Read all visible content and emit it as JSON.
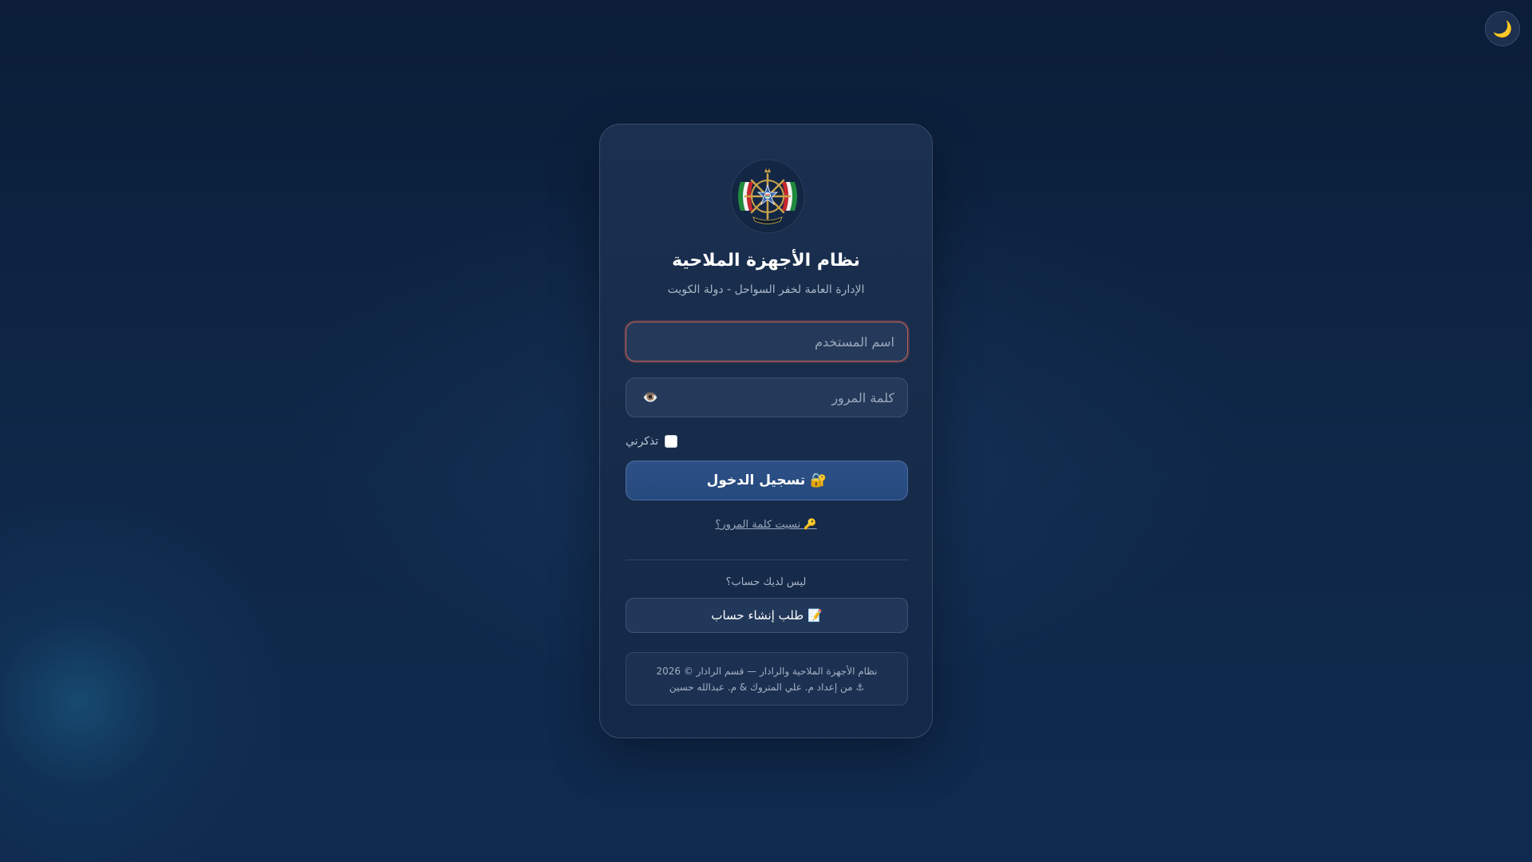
{
  "theme_toggle": {
    "icon": "🌙"
  },
  "header": {
    "title": "نظام الأجهزة الملاحية",
    "subtitle": "الإدارة العامة لخفر السواحل - دولة الكويت"
  },
  "form": {
    "username_placeholder": "اسم المستخدم",
    "password_placeholder": "كلمة المرور",
    "password_toggle_icon": "👁️",
    "remember_label": "تذكرني",
    "remember_checked": false,
    "login_label": "🔐 تسجيل الدخول",
    "forgot_label": "🔑 نسيت كلمة المرور؟"
  },
  "register": {
    "prompt": "ليس لديك حساب؟",
    "button_label": "📝 طلب إنشاء حساب"
  },
  "footer": {
    "line1": "نظام الأجهزة الملاحية والرادار — قسم الرادار © 2026",
    "line2": "⚓ من إعداد م. علي المتروك & م. عبدالله حسين"
  },
  "colors": {
    "background": "#0f2849",
    "card": "#172b4a",
    "primary_button": "#2a4d82",
    "username_border": "#c2665a"
  }
}
